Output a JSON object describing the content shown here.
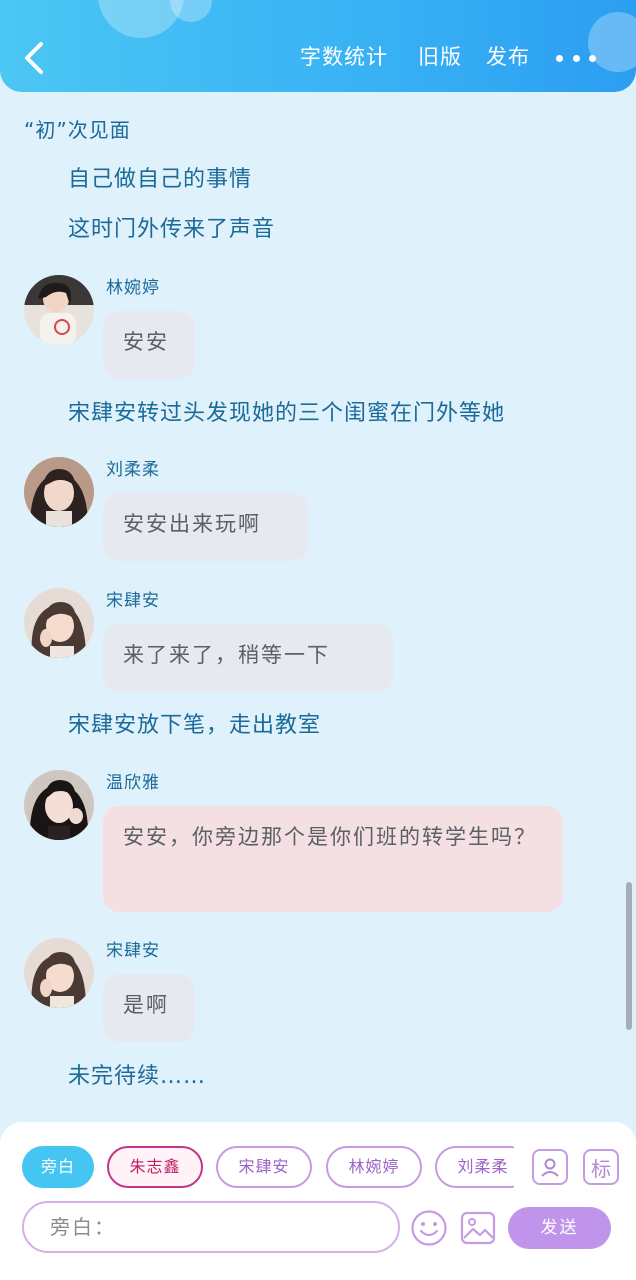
{
  "header": {
    "back_icon": "chevron-left-icon",
    "word_count_label": "字数统计",
    "old_version_label": "旧版",
    "publish_label": "发布",
    "more_icon": "more-dots-icon",
    "gradient_colors": [
      "#4cc6f3",
      "#2c9ef2"
    ]
  },
  "story": {
    "narration_1": "“初”次见面",
    "narration_2": "自己做自己的事情",
    "narration_3": "这时门外传来了声音",
    "msg_1": {
      "speaker": "林婉婷",
      "text": "安安"
    },
    "narration_4": "宋肆安转过头发现她的三个闺蜜在门外等她",
    "msg_2": {
      "speaker": "刘柔柔",
      "text": "安安出来玩啊"
    },
    "msg_3": {
      "speaker": "宋肆安",
      "text": "来了来了，稍等一下"
    },
    "narration_5": "宋肆安放下笔，走出教室",
    "msg_4": {
      "speaker": "温欣雅",
      "text": "安安，你旁边那个是你们班的转学生吗？"
    },
    "msg_5": {
      "speaker": "宋肆安",
      "text": "是啊"
    },
    "narration_6": "未完待续……"
  },
  "composer": {
    "chips": [
      "旁白",
      "朱志鑫",
      "宋肆安",
      "林婉婷",
      "刘柔柔"
    ],
    "active_chip": "旁白",
    "selected_chip": "朱志鑫",
    "contact_icon": "contact-card-icon",
    "tag_label": "标",
    "input_placeholder": "旁白：",
    "emoji_icon": "smiley-icon",
    "image_icon": "image-icon",
    "send_label": "发送",
    "accent_color": "#c094ea"
  }
}
